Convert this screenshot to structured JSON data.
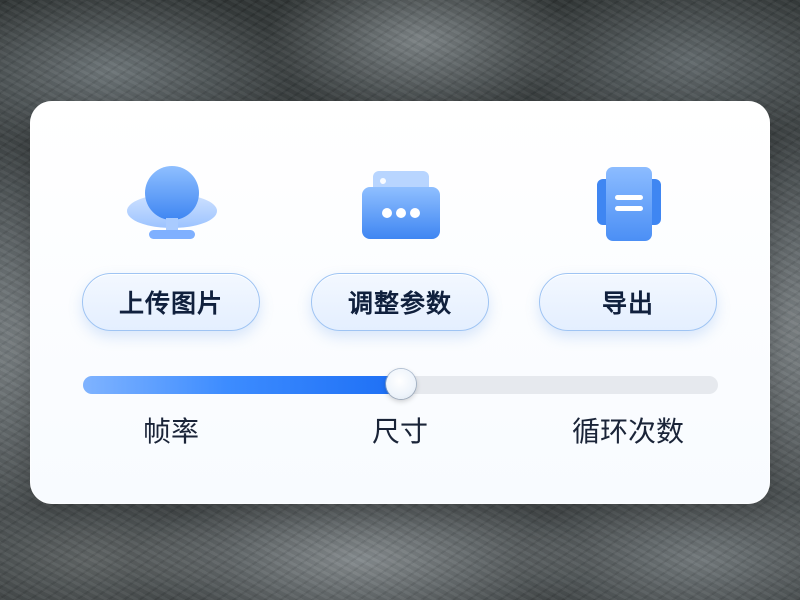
{
  "actions": [
    {
      "label": "上传图片",
      "icon": "cloud-upload-icon"
    },
    {
      "label": "调整参数",
      "icon": "settings-card-icon"
    },
    {
      "label": "导出",
      "icon": "document-export-icon"
    }
  ],
  "slider": {
    "value_fraction": 0.5,
    "labels": [
      "帧率",
      "尺寸",
      "循环次数"
    ]
  },
  "colors": {
    "accent": "#1d6ff5",
    "button_border": "#9fc4f3",
    "text": "#10203d"
  }
}
